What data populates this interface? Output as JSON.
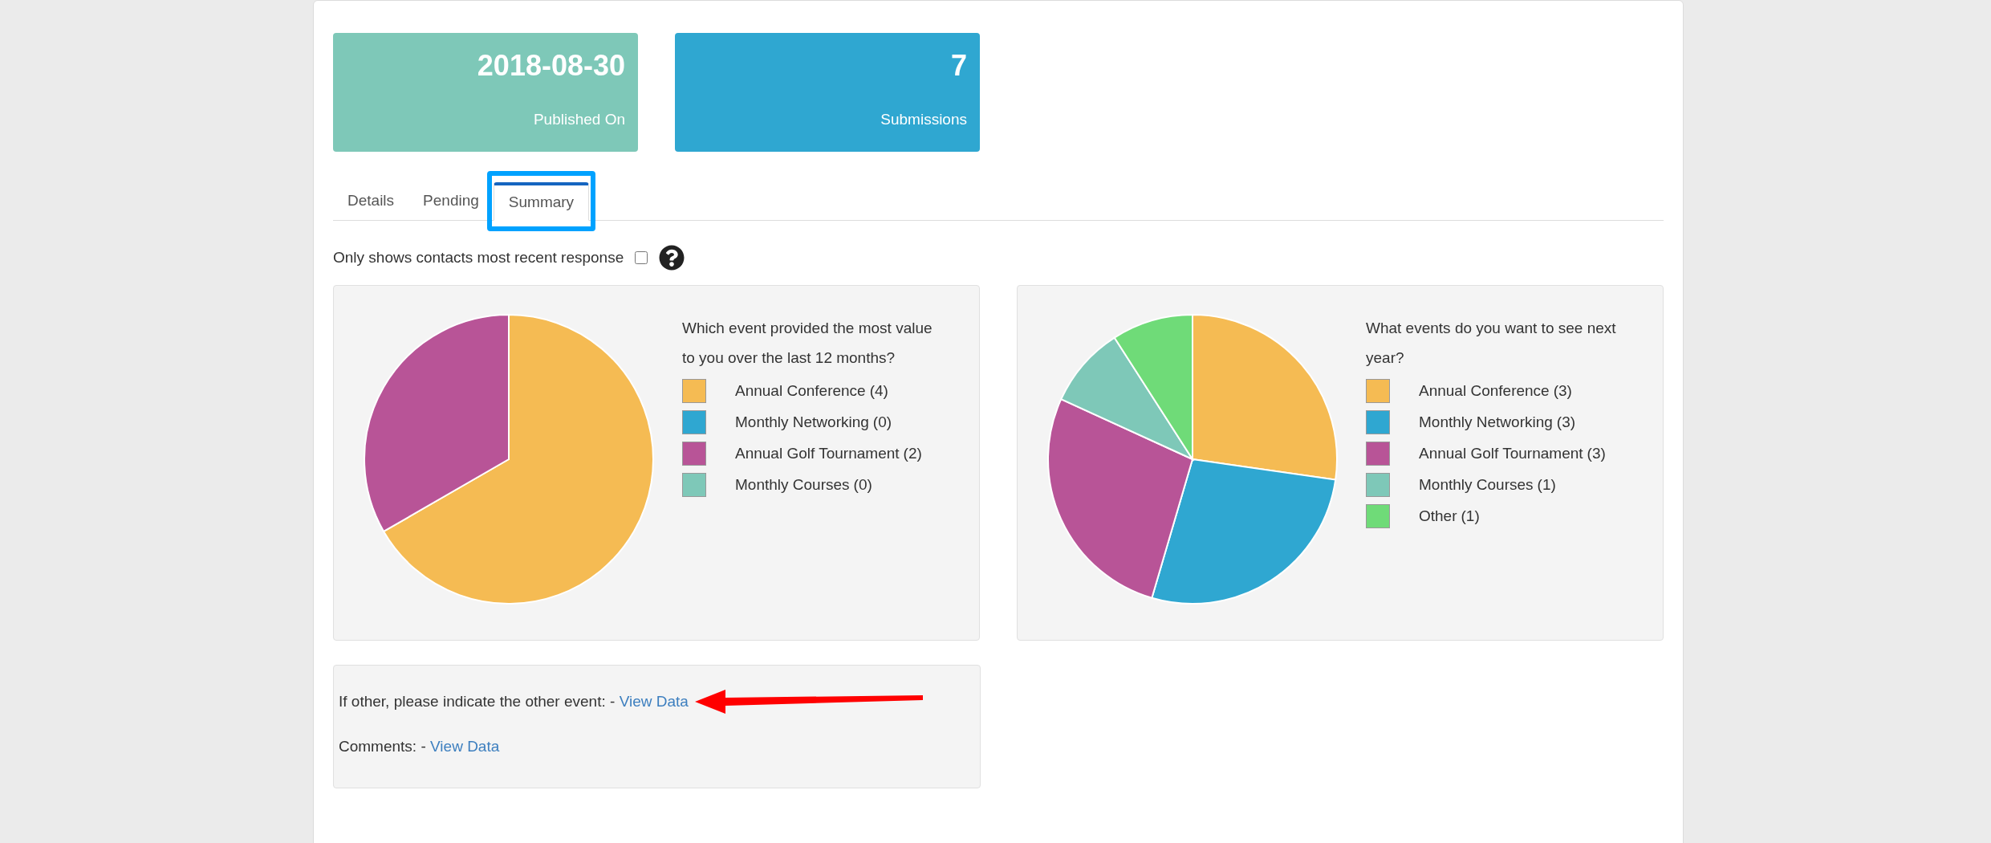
{
  "stat_cards": [
    {
      "value": "2018-08-30",
      "label": "Published On",
      "color": "#7ec8b8"
    },
    {
      "value": "7",
      "label": "Submissions",
      "color": "#2fa7d1"
    }
  ],
  "tabs": [
    {
      "label": "Details",
      "selected": false,
      "annotated": false
    },
    {
      "label": "Pending",
      "selected": false,
      "annotated": false
    },
    {
      "label": "Summary",
      "selected": true,
      "annotated": true
    }
  ],
  "filter": {
    "label": "Only shows contacts most recent response",
    "checked": false
  },
  "charts": [
    {
      "legend": [
        {
          "count": "(4)",
          "color": "#f5bb53"
        },
        {
          "count": "(0)",
          "color": "#2fa7d1"
        },
        {
          "count": "(2)",
          "color": "#b85497"
        },
        {
          "count": "(0)",
          "color": "#7ec8b8"
        }
      ],
      "chart_data": {
        "type": "pie",
        "title": "Which event provided the most value to you over the last 12 months?",
        "categories": [
          "Annual Conference",
          "Monthly Networking",
          "Annual Golf Tournament",
          "Monthly Courses"
        ],
        "values": [
          66.67,
          0,
          33.33,
          0
        ]
      }
    },
    {
      "legend": [
        {
          "count": "(3)",
          "color": "#f5bb53"
        },
        {
          "count": "(3)",
          "color": "#2fa7d1"
        },
        {
          "count": "(3)",
          "color": "#b85497"
        },
        {
          "count": "(1)",
          "color": "#7ec8b8"
        },
        {
          "count": "(1)",
          "color": "#6fdb78"
        }
      ],
      "chart_data": {
        "type": "pie",
        "title": "What events do you want to see next year?",
        "categories": [
          "Annual Conference",
          "Monthly Networking",
          "Annual Golf Tournament",
          "Monthly Courses",
          "Other"
        ],
        "values": [
          27.27,
          27.27,
          27.28,
          9.09,
          9.09
        ]
      }
    }
  ],
  "text_answers": [
    {
      "text": "If other, please indicate the other event: -",
      "link": "View Data",
      "arrow": true
    },
    {
      "text": "Comments: -",
      "link": "View Data",
      "arrow": false
    }
  ]
}
